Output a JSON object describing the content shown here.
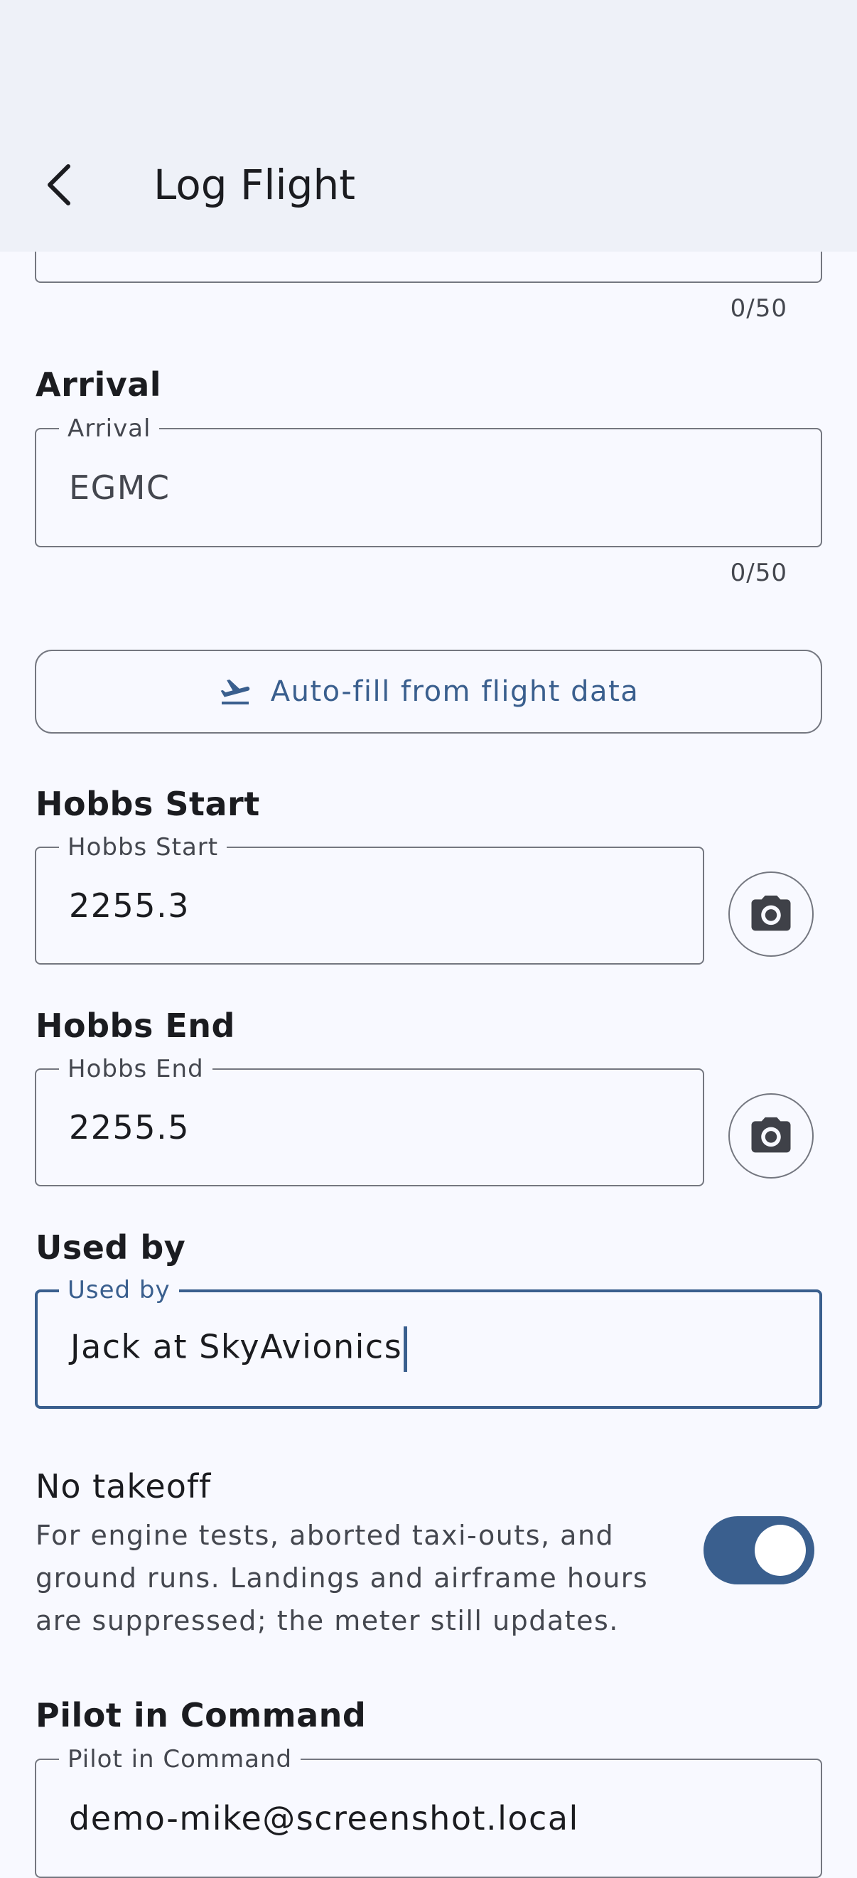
{
  "appbar": {
    "title": "Log Flight"
  },
  "departure": {
    "counter": "0/50"
  },
  "arrival": {
    "section_label": "Arrival",
    "field_label": "Arrival",
    "value": "EGMC",
    "counter": "0/50"
  },
  "autofill": {
    "label": "Auto-fill from flight data",
    "icon": "flight-takeoff-icon"
  },
  "hobbs_start": {
    "section_label": "Hobbs Start",
    "field_label": "Hobbs Start",
    "value": "2255.3",
    "icon": "camera-icon"
  },
  "hobbs_end": {
    "section_label": "Hobbs End",
    "field_label": "Hobbs End",
    "value": "2255.5",
    "icon": "camera-icon"
  },
  "used_by": {
    "section_label": "Used by",
    "field_label": "Used by",
    "value": "Jack at SkyAvionics"
  },
  "no_takeoff": {
    "title": "No takeoff",
    "description": "For engine tests, aborted taxi-outs, and ground runs. Landings and airframe hours are suppressed; the meter still updates.",
    "enabled": true
  },
  "pic": {
    "section_label": "Pilot in Command",
    "field_label": "Pilot in Command",
    "value": "demo-mike@screenshot.local"
  },
  "colors": {
    "primary": "#3a5f8e",
    "outline": "#747780",
    "background": "#f8f9ff",
    "appbar": "#eef1f8"
  }
}
